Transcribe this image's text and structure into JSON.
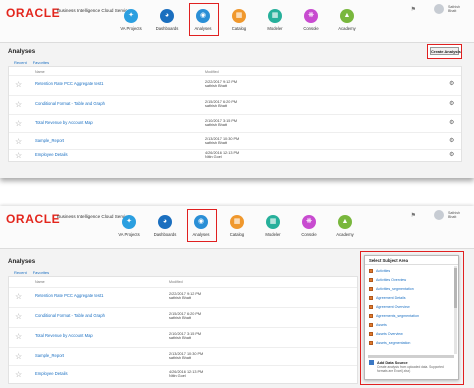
{
  "brand": {
    "logo": "ORACLE",
    "product": "Business Intelligence Cloud Service"
  },
  "user": {
    "name_line1": "Sathish",
    "name_line2": "Bhatt"
  },
  "nav": [
    {
      "label": "VA Projects",
      "icon": "va-projects-icon",
      "color": "#2b9fe0"
    },
    {
      "label": "Dashboards",
      "icon": "dashboards-icon",
      "color": "#1b6fbf"
    },
    {
      "label": "Analyses",
      "icon": "analyses-icon",
      "color": "#2a8fd6"
    },
    {
      "label": "Catalog",
      "icon": "catalog-icon",
      "color": "#f0982d"
    },
    {
      "label": "Modeler",
      "icon": "modeler-icon",
      "color": "#27b09b"
    },
    {
      "label": "Console",
      "icon": "console-icon",
      "color": "#c84bd0"
    },
    {
      "label": "Academy",
      "icon": "academy-icon",
      "color": "#79b73d"
    }
  ],
  "page": {
    "title": "Analyses",
    "tabs": [
      "Recent",
      "Favorites"
    ],
    "col_name": "Name",
    "col_modified": "Modified",
    "create_button": "Create Analysis"
  },
  "rows": [
    {
      "name": "Retention Rate PCC Aggregate test1",
      "date": "2/22/2017 9:12 PM",
      "user": "sathish Bhatt"
    },
    {
      "name": "Conditional Format - Table and Graph",
      "date": "2/15/2017 6:20 PM",
      "user": "sathish Bhatt"
    },
    {
      "name": "Total Revenue by Account Map",
      "date": "2/10/2017 3:15 PM",
      "user": "sathish Bhatt"
    },
    {
      "name": "Sample_Report",
      "date": "2/13/2017 10:30 PM",
      "user": "sathish Bhatt"
    },
    {
      "name": "Employee Details",
      "date": "4/26/2016 12:13 PM",
      "user": "Nitin Goel"
    }
  ],
  "subject_area": {
    "title": "Select Subject Area",
    "items": [
      "Activities",
      "Activities Overview",
      "Activities_segmentation",
      "Agreement Details",
      "Agreement Overview",
      "Agreements_segmentation",
      "Assets",
      "Assets Overview",
      "Assets_segmentation"
    ],
    "data_source_name": "Add Data Source",
    "data_source_desc": "Create analysis from uploaded data. Supported formats are Excel(.xlsx)"
  },
  "colors": {
    "accent_red": "#e02020",
    "link_blue": "#1a6fc2",
    "oracle_red": "#e3261d"
  }
}
